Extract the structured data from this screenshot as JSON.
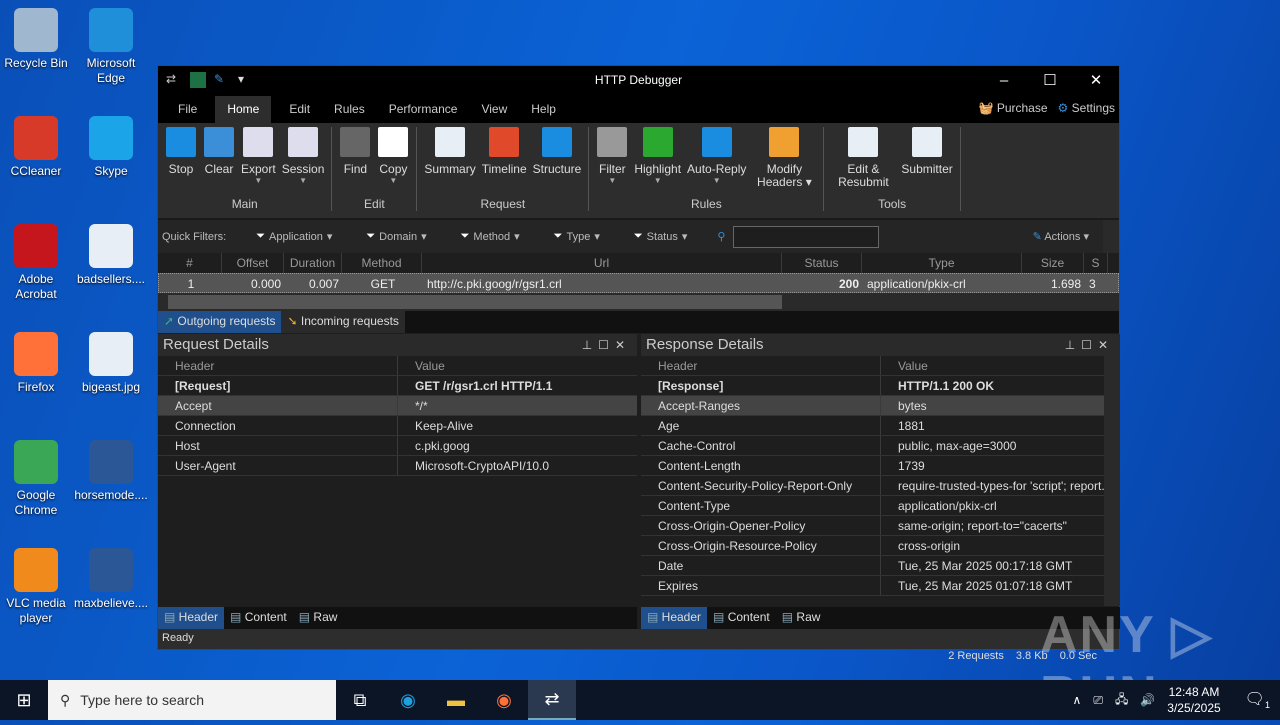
{
  "desktop": {
    "icons": [
      {
        "label": "Recycle Bin",
        "color": "#9fb8d0"
      },
      {
        "label": "Microsoft Edge",
        "color": "#1e8fd8"
      },
      {
        "label": "CCleaner",
        "color": "#d83a2a"
      },
      {
        "label": "Skype",
        "color": "#1ca4e8"
      },
      {
        "label": "Adobe Acrobat",
        "color": "#c4161c"
      },
      {
        "label": "badsellers....",
        "color": "#e8eef5"
      },
      {
        "label": "Firefox",
        "color": "#ff7139"
      },
      {
        "label": "bigeast.jpg",
        "color": "#e8eef5"
      },
      {
        "label": "Google Chrome",
        "color": "#3aa757"
      },
      {
        "label": "horsemode....",
        "color": "#2b5797"
      },
      {
        "label": "VLC media player",
        "color": "#f08a1c"
      },
      {
        "label": "maxbelieve....",
        "color": "#2b5797"
      }
    ]
  },
  "window": {
    "title": "HTTP Debugger",
    "minimize": "–",
    "maximize": "☐",
    "close": "✕"
  },
  "menu": {
    "items": [
      "File",
      "Home",
      "Edit",
      "Rules",
      "Performance",
      "View",
      "Help"
    ],
    "purchase": "Purchase",
    "settings": "Settings"
  },
  "ribbon": {
    "groups": [
      {
        "label": "Main",
        "buttons": [
          {
            "label": "Stop",
            "color": "#1a8de0"
          },
          {
            "label": "Clear",
            "color": "#3a8fd8"
          },
          {
            "label": "Export",
            "color": "#dde",
            "dd": true
          },
          {
            "label": "Session",
            "color": "#dde",
            "dd": true
          }
        ]
      },
      {
        "label": "Edit",
        "buttons": [
          {
            "label": "Find",
            "color": "#666"
          },
          {
            "label": "Copy",
            "color": "#fff",
            "dd": true
          }
        ]
      },
      {
        "label": "Request",
        "buttons": [
          {
            "label": "Summary",
            "color": "#e8eef5"
          },
          {
            "label": "Timeline",
            "color": "#e04a2a"
          },
          {
            "label": "Structure",
            "color": "#1a8de0"
          }
        ]
      },
      {
        "label": "Rules",
        "buttons": [
          {
            "label": "Filter",
            "color": "#999",
            "dd": true
          },
          {
            "label": "Highlight",
            "color": "#2aa830",
            "dd": true
          },
          {
            "label": "Auto-Reply",
            "color": "#1a8de0",
            "dd": true
          },
          {
            "label": "Modify Headers ▾",
            "color": "#f0a030"
          }
        ]
      },
      {
        "label": "Tools",
        "buttons": [
          {
            "label": "Edit & Resubmit",
            "color": "#e8eef5"
          },
          {
            "label": "Submitter",
            "color": "#e8eef5"
          }
        ]
      }
    ]
  },
  "quick_filters": {
    "label": "Quick Filters:",
    "filters": [
      "Application",
      "Domain",
      "Method",
      "Type",
      "Status"
    ],
    "search_value": "",
    "actions": "Actions"
  },
  "grid": {
    "columns": [
      "#",
      "Offset",
      "Duration",
      "Method",
      "Url",
      "Status",
      "Type",
      "Size",
      "S"
    ],
    "rows": [
      {
        "num": "1",
        "offset": "0.000",
        "duration": "0.007",
        "method": "GET",
        "url": "http://c.pki.goog/r/gsr1.crl",
        "status": "200",
        "type": "application/pkix-crl",
        "size": "1.698",
        "s": "3"
      }
    ]
  },
  "traffic_tabs": [
    "Outgoing requests",
    "Incoming requests"
  ],
  "request": {
    "title": "Request Details",
    "col_header": "Header",
    "col_value": "Value",
    "rows": [
      [
        "[Request]",
        "GET /r/gsr1.crl HTTP/1.1"
      ],
      [
        "Accept",
        "*/*"
      ],
      [
        "Connection",
        "Keep-Alive"
      ],
      [
        "Host",
        "c.pki.goog"
      ],
      [
        "User-Agent",
        "Microsoft-CryptoAPI/10.0"
      ]
    ]
  },
  "response": {
    "title": "Response Details",
    "col_header": "Header",
    "col_value": "Value",
    "rows": [
      [
        "[Response]",
        "HTTP/1.1 200 OK"
      ],
      [
        "Accept-Ranges",
        "bytes"
      ],
      [
        "Age",
        "1881"
      ],
      [
        "Cache-Control",
        "public, max-age=3000"
      ],
      [
        "Content-Length",
        "1739"
      ],
      [
        "Content-Security-Policy-Report-Only",
        "require-trusted-types-for 'script'; report..."
      ],
      [
        "Content-Type",
        "application/pkix-crl"
      ],
      [
        "Cross-Origin-Opener-Policy",
        "same-origin; report-to=\"cacerts\""
      ],
      [
        "Cross-Origin-Resource-Policy",
        "cross-origin"
      ],
      [
        "Date",
        "Tue, 25 Mar 2025 00:17:18 GMT"
      ],
      [
        "Expires",
        "Tue, 25 Mar 2025 01:07:18 GMT"
      ]
    ]
  },
  "detail_tabs": [
    "Header",
    "Content",
    "Raw"
  ],
  "status": {
    "text": "Ready",
    "requests": "2 Requests",
    "size": "3.8 Kb",
    "time": "0.0 Sec"
  },
  "taskbar": {
    "search_placeholder": "Type here to search",
    "time": "12:48 AM",
    "date": "3/25/2025",
    "notifications": "1"
  },
  "watermark": "ANY ▷ RUN"
}
